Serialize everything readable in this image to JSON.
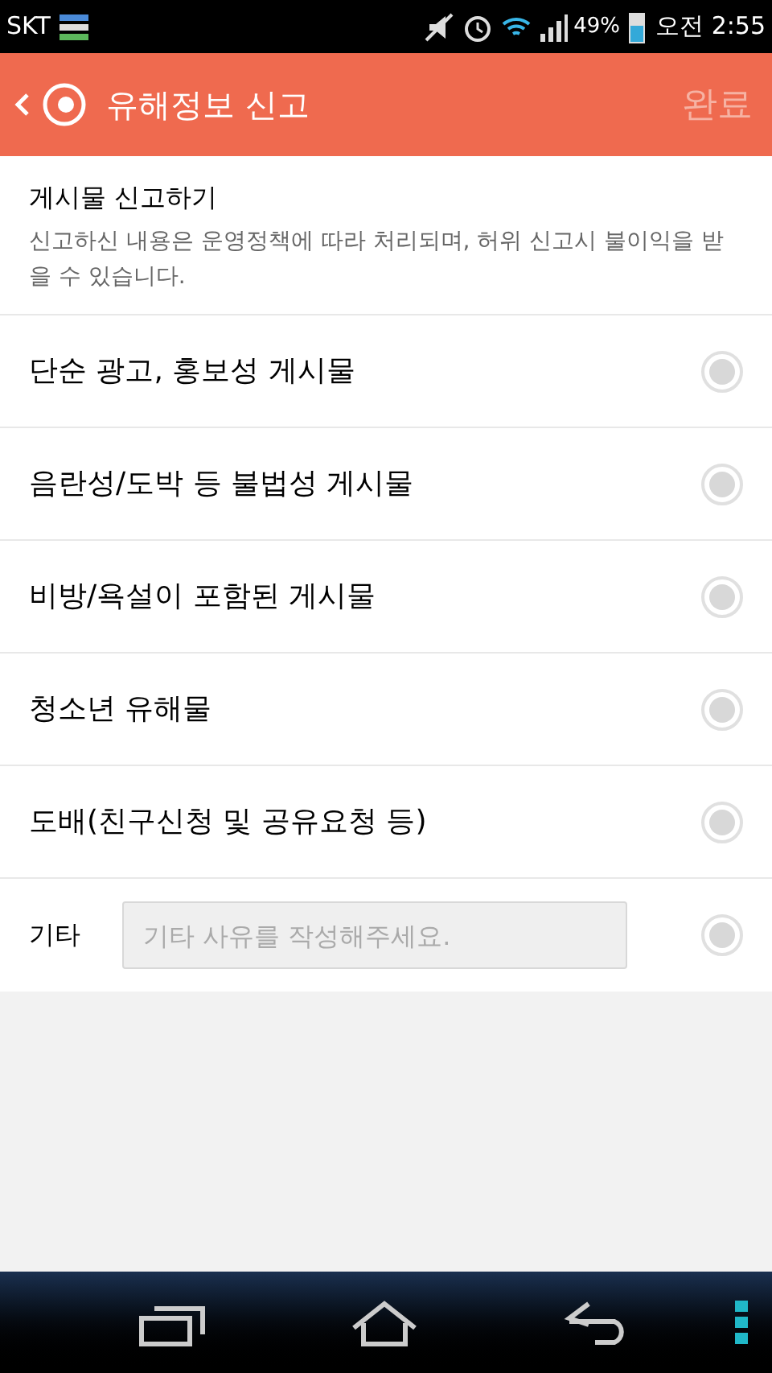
{
  "status_bar": {
    "carrier": "SKT",
    "battery_text": "49%",
    "time": "오전 2:55"
  },
  "header": {
    "title": "유해정보 신고",
    "done": {
      "label": "완료",
      "disabled": true
    }
  },
  "intro": {
    "title": "게시물 신고하기",
    "description": "신고하신 내용은 운영정책에 따라 처리되며, 허위 신고시 불이익을 받을 수 있습니다."
  },
  "options": [
    {
      "kind": "plain",
      "label": "단순 광고, 홍보성 게시물",
      "selected": false
    },
    {
      "kind": "plain",
      "label": "음란성/도박 등 불법성 게시물",
      "selected": false
    },
    {
      "kind": "plain",
      "label": "비방/욕설이 포함된 게시물",
      "selected": false
    },
    {
      "kind": "plain",
      "label": "청소년 유해물",
      "selected": false
    },
    {
      "kind": "plain",
      "label": "도배(친구신청 및 공유요청 등)",
      "selected": false
    },
    {
      "kind": "other",
      "label": "기타",
      "placeholder": "기타 사유를 작성해주세요.",
      "selected": false
    }
  ]
}
